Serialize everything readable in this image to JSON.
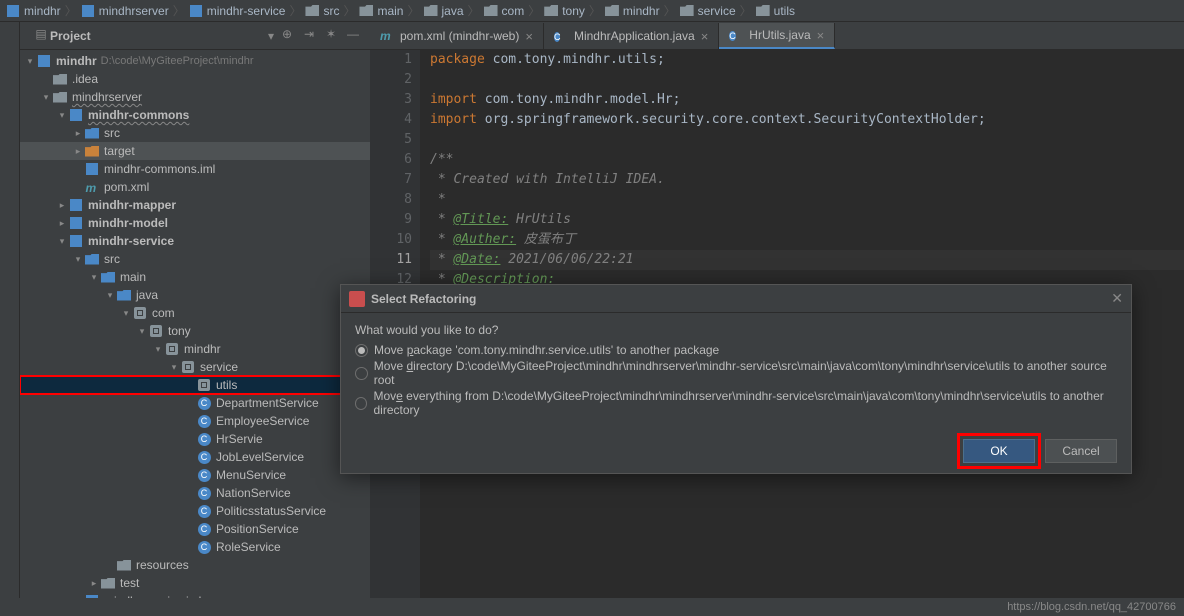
{
  "breadcrumb": [
    "mindhr",
    "mindhrserver",
    "mindhr-service",
    "src",
    "main",
    "java",
    "com",
    "tony",
    "mindhr",
    "service",
    "utils"
  ],
  "sidebar": {
    "title": "Project",
    "root": {
      "label": "mindhr",
      "hint": "D:\\code\\MyGiteeProject\\mindhr"
    },
    "items": [
      {
        "label": ".idea",
        "depth": 1,
        "icon": "folder",
        "arrow": ""
      },
      {
        "label": "mindhrserver",
        "depth": 1,
        "icon": "folder",
        "arrow": "▾",
        "wavy": true
      },
      {
        "label": "mindhr-commons",
        "depth": 2,
        "icon": "module",
        "arrow": "▾",
        "bold": true,
        "wavy": true
      },
      {
        "label": "src",
        "depth": 3,
        "icon": "folder-blue",
        "arrow": "▸"
      },
      {
        "label": "target",
        "depth": 3,
        "icon": "folder-orange",
        "arrow": "▸",
        "highlight": true
      },
      {
        "label": "mindhr-commons.iml",
        "depth": 3,
        "icon": "iml",
        "arrow": ""
      },
      {
        "label": "pom.xml",
        "depth": 3,
        "icon": "m",
        "arrow": ""
      },
      {
        "label": "mindhr-mapper",
        "depth": 2,
        "icon": "module",
        "arrow": "▸",
        "bold": true
      },
      {
        "label": "mindhr-model",
        "depth": 2,
        "icon": "module",
        "arrow": "▸",
        "bold": true
      },
      {
        "label": "mindhr-service",
        "depth": 2,
        "icon": "module",
        "arrow": "▾",
        "bold": true
      },
      {
        "label": "src",
        "depth": 3,
        "icon": "folder-blue",
        "arrow": "▾"
      },
      {
        "label": "main",
        "depth": 4,
        "icon": "folder-blue",
        "arrow": "▾"
      },
      {
        "label": "java",
        "depth": 5,
        "icon": "folder-blue",
        "arrow": "▾"
      },
      {
        "label": "com",
        "depth": 6,
        "icon": "package",
        "arrow": "▾"
      },
      {
        "label": "tony",
        "depth": 7,
        "icon": "package",
        "arrow": "▾"
      },
      {
        "label": "mindhr",
        "depth": 8,
        "icon": "package",
        "arrow": "▾"
      },
      {
        "label": "service",
        "depth": 9,
        "icon": "package",
        "arrow": "▾"
      },
      {
        "label": "utils",
        "depth": 10,
        "icon": "package",
        "arrow": "",
        "selected": true,
        "redbox": true
      },
      {
        "label": "DepartmentService",
        "depth": 10,
        "icon": "class",
        "arrow": ""
      },
      {
        "label": "EmployeeService",
        "depth": 10,
        "icon": "class",
        "arrow": ""
      },
      {
        "label": "HrServie",
        "depth": 10,
        "icon": "class",
        "arrow": ""
      },
      {
        "label": "JobLevelService",
        "depth": 10,
        "icon": "class",
        "arrow": ""
      },
      {
        "label": "MenuService",
        "depth": 10,
        "icon": "class",
        "arrow": ""
      },
      {
        "label": "NationService",
        "depth": 10,
        "icon": "class",
        "arrow": ""
      },
      {
        "label": "PoliticsstatusService",
        "depth": 10,
        "icon": "class",
        "arrow": ""
      },
      {
        "label": "PositionService",
        "depth": 10,
        "icon": "class",
        "arrow": ""
      },
      {
        "label": "RoleService",
        "depth": 10,
        "icon": "class",
        "arrow": ""
      },
      {
        "label": "resources",
        "depth": 5,
        "icon": "folder-grey",
        "arrow": ""
      },
      {
        "label": "test",
        "depth": 4,
        "icon": "folder",
        "arrow": "▸"
      },
      {
        "label": "mindhr-service.iml",
        "depth": 3,
        "icon": "iml",
        "arrow": ""
      }
    ]
  },
  "tabs": [
    {
      "label": "pom.xml (mindhr-web)",
      "icon": "m",
      "active": false
    },
    {
      "label": "MindhrApplication.java",
      "icon": "class",
      "active": false
    },
    {
      "label": "HrUtils.java",
      "icon": "class",
      "active": true
    }
  ],
  "code": {
    "lines": [
      {
        "n": 1,
        "html": "<span class='kw'>package</span> com.tony.mindhr.utils;"
      },
      {
        "n": 2,
        "html": ""
      },
      {
        "n": 3,
        "html": "<span class='kw'>import</span> com.tony.mindhr.model.Hr;"
      },
      {
        "n": 4,
        "html": "<span class='kw'>import</span> org.springframework.security.core.context.SecurityContextHolder;"
      },
      {
        "n": 5,
        "html": ""
      },
      {
        "n": 6,
        "html": "<span class='comment'>/**</span>"
      },
      {
        "n": 7,
        "html": "<span class='comment'> * Created with IntelliJ IDEA.</span>"
      },
      {
        "n": 8,
        "html": "<span class='comment'> *</span>"
      },
      {
        "n": 9,
        "html": "<span class='comment'> * <span class='tag'>@Title:</span> HrUtils</span>"
      },
      {
        "n": 10,
        "html": "<span class='comment'> * <span class='tag'>@Auther:</span> 皮蛋布丁</span>"
      },
      {
        "n": 11,
        "html": "<span class='comment'> * <span class='tag'>@Date:</span> 2021/06/06/22:21</span>",
        "active": true
      },
      {
        "n": 12,
        "html": "<span class='comment'> * <span class='tag'>@Description:</span></span>"
      }
    ]
  },
  "dialog": {
    "title": "Select Refactoring",
    "prompt": "What would you like to do?",
    "options": [
      {
        "text_pre": "Move ",
        "u": "p",
        "text_post": "ackage 'com.tony.mindhr.service.utils' to another package",
        "checked": true
      },
      {
        "text_pre": "Move ",
        "u": "d",
        "text_post": "irectory D:\\code\\MyGiteeProject\\mindhr\\mindhrserver\\mindhr-service\\src\\main\\java\\com\\tony\\mindhr\\service\\utils to another source root",
        "checked": false
      },
      {
        "text_pre": "Mov",
        "u": "e",
        "text_post": " everything from D:\\code\\MyGiteeProject\\mindhr\\mindhrserver\\mindhr-service\\src\\main\\java\\com\\tony\\mindhr\\service\\utils to another directory",
        "checked": false
      }
    ],
    "ok": "OK",
    "cancel": "Cancel"
  },
  "status": "https://blog.csdn.net/qq_42700766"
}
